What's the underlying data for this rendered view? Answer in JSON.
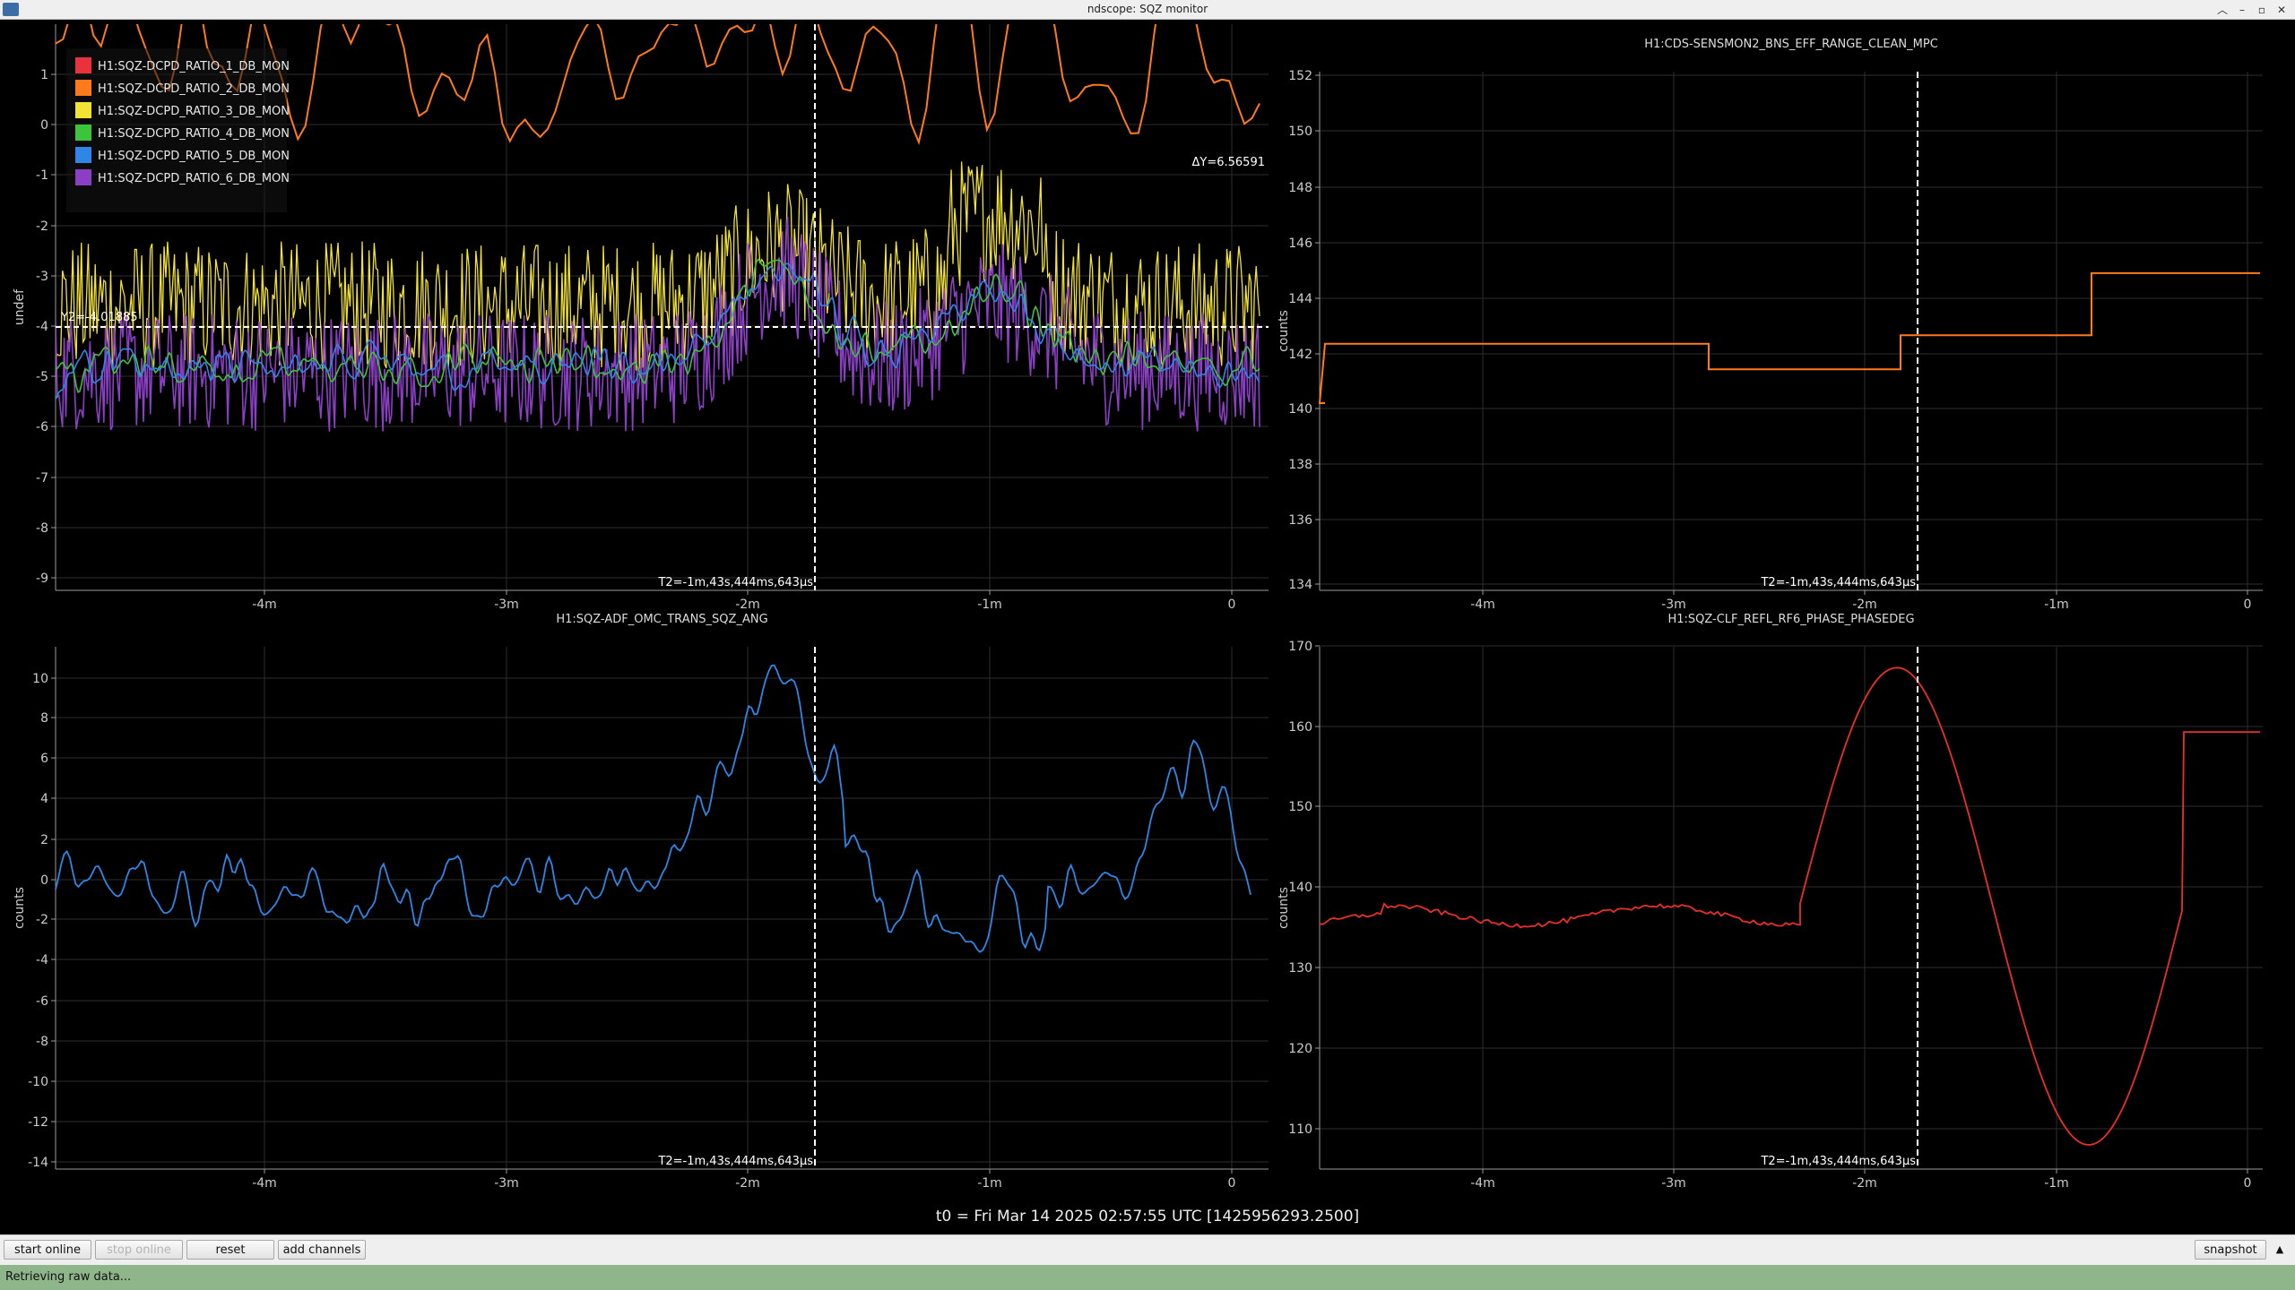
{
  "window": {
    "title": "ndscope: SQZ monitor"
  },
  "colors": {
    "bg": "#000000",
    "grid": "#2e2e2e",
    "axis": "#9a9a9a",
    "cursor": "#ffffff"
  },
  "plots": [
    {
      "id": "p1",
      "title": "",
      "ylabel": "undef",
      "yticks": [
        "1",
        "0",
        "-1",
        "-2",
        "-3",
        "-4",
        "-5",
        "-6",
        "-7",
        "-8",
        "-9"
      ],
      "xticks": [
        "-4m",
        "-3m",
        "-2m",
        "-1m",
        "0"
      ],
      "ylim": [
        -9.4,
        1.8
      ],
      "legend": [
        {
          "name": "H1:SQZ-DCPD_RATIO_1_DB_MON",
          "color": "#e8323c"
        },
        {
          "name": "H1:SQZ-DCPD_RATIO_2_DB_MON",
          "color": "#ff7a1a"
        },
        {
          "name": "H1:SQZ-DCPD_RATIO_3_DB_MON",
          "color": "#f2e233"
        },
        {
          "name": "H1:SQZ-DCPD_RATIO_4_DB_MON",
          "color": "#3cc43c"
        },
        {
          "name": "H1:SQZ-DCPD_RATIO_5_DB_MON",
          "color": "#2f86e6"
        },
        {
          "name": "H1:SQZ-DCPD_RATIO_6_DB_MON",
          "color": "#8b3fc4"
        }
      ],
      "cursor_t": "T2=-1m,43s,444ms,643µs",
      "cursor_y": "Y2=-4.01885",
      "delta_y": "ΔY=6.56591"
    },
    {
      "id": "p2",
      "title": "H1:CDS-SENSMON2_BNS_EFF_RANGE_CLEAN_MPC",
      "ylabel": "counts",
      "yticks": [
        "152",
        "150",
        "148",
        "146",
        "144",
        "142",
        "140",
        "138",
        "136",
        "134"
      ],
      "xticks": [
        "-4m",
        "-3m",
        "-2m",
        "-1m",
        "0"
      ],
      "ylim": [
        134,
        152.4
      ],
      "color": "#ff7a1a",
      "cursor_t": "T2=-1m,43s,444ms,643µs"
    },
    {
      "id": "p3",
      "title": "H1:SQZ-ADF_OMC_TRANS_SQZ_ANG",
      "ylabel": "counts",
      "yticks": [
        "10",
        "8",
        "6",
        "4",
        "2",
        "0",
        "-2",
        "-4",
        "-6",
        "-8",
        "-10",
        "-12",
        "-14"
      ],
      "xticks": [
        "-4m",
        "-3m",
        "-2m",
        "-1m",
        "0"
      ],
      "ylim": [
        -14.3,
        11.4
      ],
      "color": "#2f86e6",
      "cursor_t": "T2=-1m,43s,444ms,643µs"
    },
    {
      "id": "p4",
      "title": "H1:SQZ-CLF_REFL_RF6_PHASE_PHASEDEG",
      "ylabel": "counts",
      "yticks": [
        "170",
        "160",
        "150",
        "140",
        "130",
        "120",
        "110"
      ],
      "xticks": [
        "-4m",
        "-3m",
        "-2m",
        "-1m",
        "0"
      ],
      "ylim": [
        104,
        170.3
      ],
      "color": "#e8302a",
      "cursor_t": "T2=-1m,43s,444ms,643µs"
    }
  ],
  "t0_label": "t0 = Fri Mar 14 2025 02:57:55 UTC [1425956293.2500]",
  "buttons": {
    "start_online": "start online",
    "stop_online": "stop online",
    "reset": "reset",
    "add_channels": "add channels",
    "snapshot": "snapshot"
  },
  "status": "Retrieving raw data..."
}
